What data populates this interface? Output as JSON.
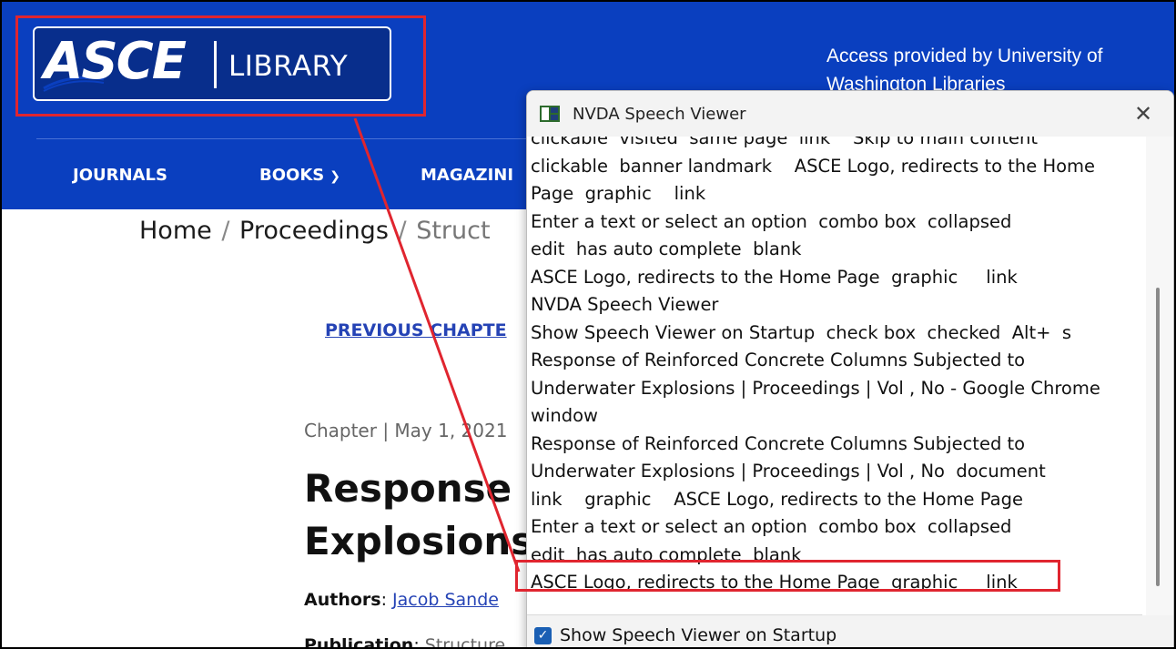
{
  "header": {
    "logo_asce": "ASCE",
    "logo_library": "LIBRARY",
    "access_text": "Access provided by University of Washington Libraries",
    "nav": [
      {
        "label": "JOURNALS"
      },
      {
        "label": "BOOKS"
      },
      {
        "label": "MAGAZINI"
      }
    ],
    "colors": {
      "brand_blue": "#0a3fbf",
      "annotation_red": "#e0252f"
    }
  },
  "breadcrumb": {
    "home": "Home",
    "sep1": "/",
    "proceedings": "Proceedings",
    "sep2": "/",
    "current": "Struct"
  },
  "article": {
    "previous_chapter": "PREVIOUS CHAPTE",
    "chapter_meta": "Chapter  |  May 1, 2021",
    "title_line1": "Response",
    "title_line2": "Explosions",
    "authors_label": "Authors",
    "authors_sep": ": ",
    "author_link": "Jacob Sande",
    "publication_label": "Publication",
    "publication_sep": ": ",
    "publication_value": "Structure"
  },
  "nvda": {
    "window_title": "NVDA Speech Viewer",
    "close_icon": "close-icon",
    "lines": [
      "clickable  visited  same page  link    Skip to main content",
      "clickable  banner landmark    ASCE Logo, redirects to the Home",
      "Page  graphic    link",
      "Enter a text or select an option  combo box  collapsed",
      "edit  has auto complete  blank",
      "ASCE Logo, redirects to the Home Page  graphic     link",
      "NVDA Speech Viewer",
      "Show Speech Viewer on Startup  check box  checked  Alt+  s",
      "Response of Reinforced Concrete Columns Subjected to",
      "Underwater Explosions | Proceedings | Vol , No - Google Chrome",
      "window",
      "Response of Reinforced Concrete Columns Subjected to",
      "Underwater Explosions | Proceedings | Vol , No  document",
      "link    graphic    ASCE Logo, redirects to the Home Page",
      "Enter a text or select an option  combo box  collapsed",
      "edit  has auto complete  blank",
      "ASCE Logo, redirects to the Home Page  graphic     link"
    ],
    "checkbox_label": "Show Speech Viewer on Startup",
    "checkbox_checked": true
  }
}
